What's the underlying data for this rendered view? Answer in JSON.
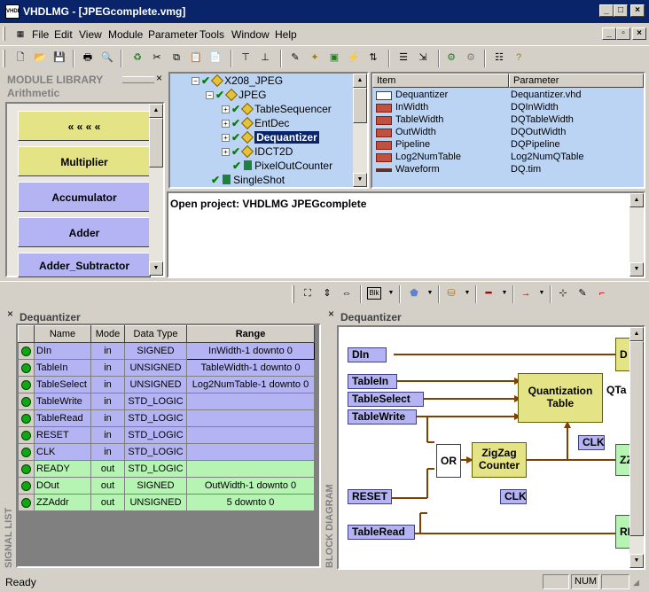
{
  "window": {
    "title": "VHDLMG - [JPEGcomplete.vmg]",
    "app_icon": "VHDL",
    "minimize": "_",
    "maximize": "□",
    "close": "×"
  },
  "menu": {
    "items": [
      "File",
      "Edit",
      "View",
      "Module",
      "Parameter",
      "Tools",
      "Window",
      "Help"
    ],
    "mdi": [
      "_",
      "▫",
      "×"
    ]
  },
  "module_library": {
    "header": "MODULE LIBRARY",
    "close": "×",
    "category": "Arithmetic",
    "items": [
      {
        "label": "« « « «",
        "color": "yellow"
      },
      {
        "label": "Multiplier",
        "color": "yellow"
      },
      {
        "label": "Accumulator",
        "color": "lavender"
      },
      {
        "label": "Adder",
        "color": "lavender"
      },
      {
        "label": "Adder_Subtractor",
        "color": "lavender"
      }
    ]
  },
  "tree": {
    "items": [
      {
        "label": "X208_JPEG",
        "icon": "gear-icon",
        "level": 0
      },
      {
        "label": "JPEG",
        "icon": "gear-icon",
        "level": 1
      },
      {
        "label": "TableSequencer",
        "icon": "gear-icon",
        "level": 2
      },
      {
        "label": "EntDec",
        "icon": "gear-icon",
        "level": 2
      },
      {
        "label": "Dequantizer",
        "icon": "gear-icon",
        "level": 2,
        "selected": true
      },
      {
        "label": "IDCT2D",
        "icon": "gear-icon",
        "level": 2
      },
      {
        "label": "PixelOutCounter",
        "icon": "module-icon",
        "level": 2
      },
      {
        "label": "SingleShot",
        "icon": "module-icon",
        "level": 1
      }
    ]
  },
  "params": {
    "headers": [
      "Item",
      "Parameter"
    ],
    "rows": [
      {
        "item": "Dequantizer",
        "param": "Dequantizer.vhd",
        "icon": "vhdl-file-icon"
      },
      {
        "item": "InWidth",
        "param": "DQInWidth",
        "icon": "param-icon"
      },
      {
        "item": "TableWidth",
        "param": "DQTableWidth",
        "icon": "param-icon"
      },
      {
        "item": "OutWidth",
        "param": "DQOutWidth",
        "icon": "param-icon"
      },
      {
        "item": "Pipeline",
        "param": "DQPipeline",
        "icon": "param-icon"
      },
      {
        "item": "Log2NumTable",
        "param": "Log2NumQTable",
        "icon": "param-icon"
      },
      {
        "item": "Waveform",
        "param": "DQ.tim",
        "icon": "waveform-icon"
      }
    ]
  },
  "output": {
    "text": "Open project: VHDLMG JPEGcomplete"
  },
  "signal_list": {
    "title": "Dequantizer",
    "side_label": "SIGNAL LIST",
    "close": "×",
    "headers": [
      "Name",
      "Mode",
      "Data Type",
      "Range"
    ],
    "rows": [
      {
        "name": "DIn",
        "mode": "in",
        "type": "SIGNED",
        "range": "InWidth-1 downto 0",
        "kind": "in"
      },
      {
        "name": "TableIn",
        "mode": "in",
        "type": "UNSIGNED",
        "range": "TableWidth-1 downto 0",
        "kind": "in"
      },
      {
        "name": "TableSelect",
        "mode": "in",
        "type": "UNSIGNED",
        "range": "Log2NumTable-1 downto 0",
        "kind": "in"
      },
      {
        "name": "TableWrite",
        "mode": "in",
        "type": "STD_LOGIC",
        "range": "",
        "kind": "in"
      },
      {
        "name": "TableRead",
        "mode": "in",
        "type": "STD_LOGIC",
        "range": "",
        "kind": "in"
      },
      {
        "name": "RESET",
        "mode": "in",
        "type": "STD_LOGIC",
        "range": "",
        "kind": "in"
      },
      {
        "name": "CLK",
        "mode": "in",
        "type": "STD_LOGIC",
        "range": "",
        "kind": "in"
      },
      {
        "name": "READY",
        "mode": "out",
        "type": "STD_LOGIC",
        "range": "",
        "kind": "out"
      },
      {
        "name": "DOut",
        "mode": "out",
        "type": "SIGNED",
        "range": "OutWidth-1 downto 0",
        "kind": "out"
      },
      {
        "name": "ZZAddr",
        "mode": "out",
        "type": "UNSIGNED",
        "range": "5 downto 0",
        "kind": "out"
      }
    ]
  },
  "block_diagram": {
    "title": "Dequantizer",
    "side_label": "BLOCK DIAGRAM",
    "close": "×",
    "ports": [
      "DIn",
      "TableIn",
      "TableSelect",
      "TableWrite",
      "RESET",
      "TableRead"
    ],
    "blocks": {
      "qt": "Quantization Table",
      "or": "OR",
      "zz": "ZigZag Counter",
      "clk1": "CLK",
      "clk2": "CLK",
      "qt_out": "QTa",
      "rb1": "D",
      "rb2": "ZZ",
      "rb3": "RE"
    }
  },
  "status": {
    "text": "Ready",
    "indicators": [
      "",
      "NUM",
      ""
    ]
  }
}
